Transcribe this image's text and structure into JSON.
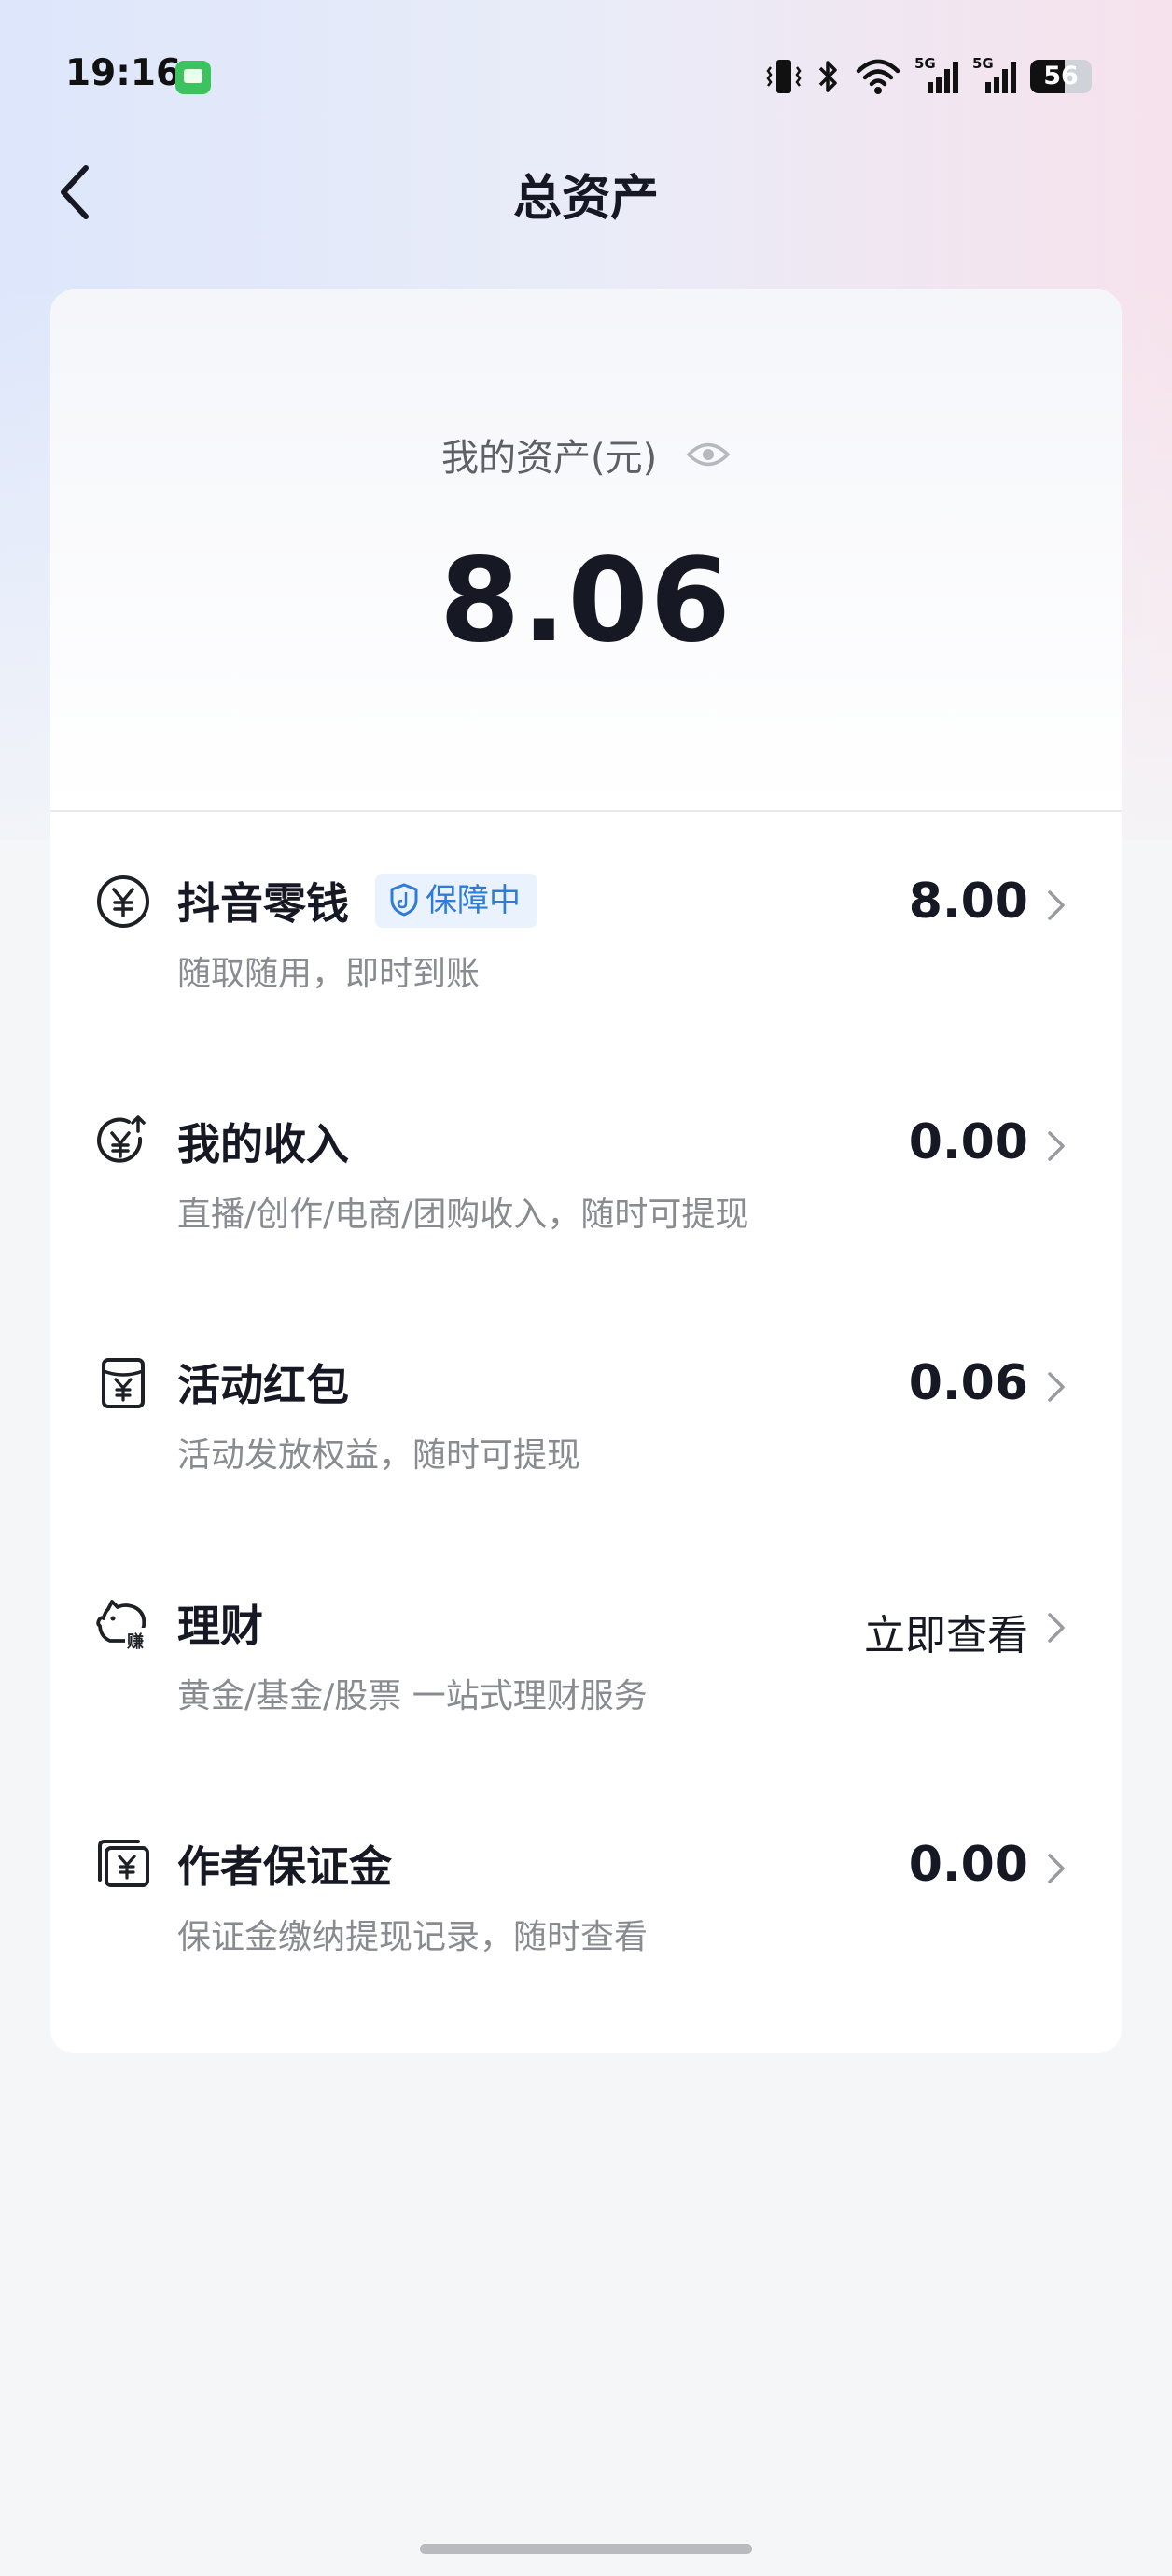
{
  "status_bar": {
    "time": "19:16",
    "battery": "56",
    "battery_level": 0.56,
    "icons": [
      "message-app-icon",
      "vibrate-icon",
      "bluetooth-icon",
      "wifi-icon",
      "signal-5g-icon",
      "signal-5g-icon"
    ]
  },
  "header": {
    "title": "总资产",
    "back_icon": "chevron-left-icon"
  },
  "summary": {
    "label": "我的资产(元)",
    "value": "8.06",
    "eye_icon": "eye-icon"
  },
  "items": [
    {
      "icon": "yuan-coin-icon",
      "title": "抖音零钱",
      "badge": "保障中",
      "subtitle": "随取随用，即时到账",
      "value": "8.00"
    },
    {
      "icon": "yuan-income-icon",
      "title": "我的收入",
      "subtitle": "直播/创作/电商/团购收入，随时可提现",
      "value": "0.00"
    },
    {
      "icon": "red-envelope-icon",
      "title": "活动红包",
      "subtitle": "活动发放权益，随时可提现",
      "value": "0.06"
    },
    {
      "icon": "piggy-bank-icon",
      "title": "理财",
      "subtitle": "黄金/基金/股票 一站式理财服务",
      "value": "立即查看"
    },
    {
      "icon": "deposit-card-icon",
      "title": "作者保证金",
      "subtitle": "保证金缴纳提现记录，随时查看",
      "value": "0.00"
    }
  ],
  "colors": {
    "accent_blue": "#2f7cd8",
    "text_primary": "#161823",
    "text_secondary": "#8a8b91"
  }
}
